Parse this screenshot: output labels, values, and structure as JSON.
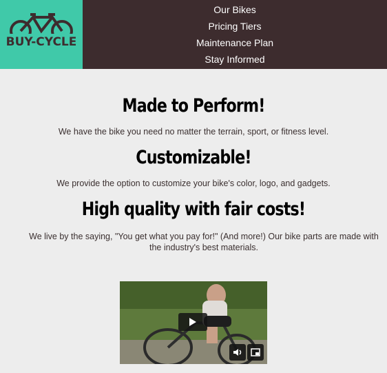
{
  "brand": {
    "logo_text": "BUY-CYCLE"
  },
  "nav": {
    "items": [
      "Our Bikes",
      "Pricing Tiers",
      "Maintenance Plan",
      "Stay Informed"
    ]
  },
  "sections": [
    {
      "heading": "Made to Perform!",
      "text": "We have the bike you need no matter the terrain, sport, or fitness level."
    },
    {
      "heading": "Customizable!",
      "text": "We provide the option to customize your bike's color, logo, and gadgets."
    },
    {
      "heading": "High quality with fair costs!",
      "text": "We live by the saying, \"You get what you pay for!\" (And more!) Our bike parts are made with the industry's best materials."
    }
  ],
  "video": {
    "controls": [
      "play-icon",
      "volume-icon",
      "picture-in-picture-icon"
    ]
  },
  "colors": {
    "logo_bg": "#40c9a9",
    "nav_bg": "#3d2c2e",
    "page_bg": "#ededed"
  }
}
